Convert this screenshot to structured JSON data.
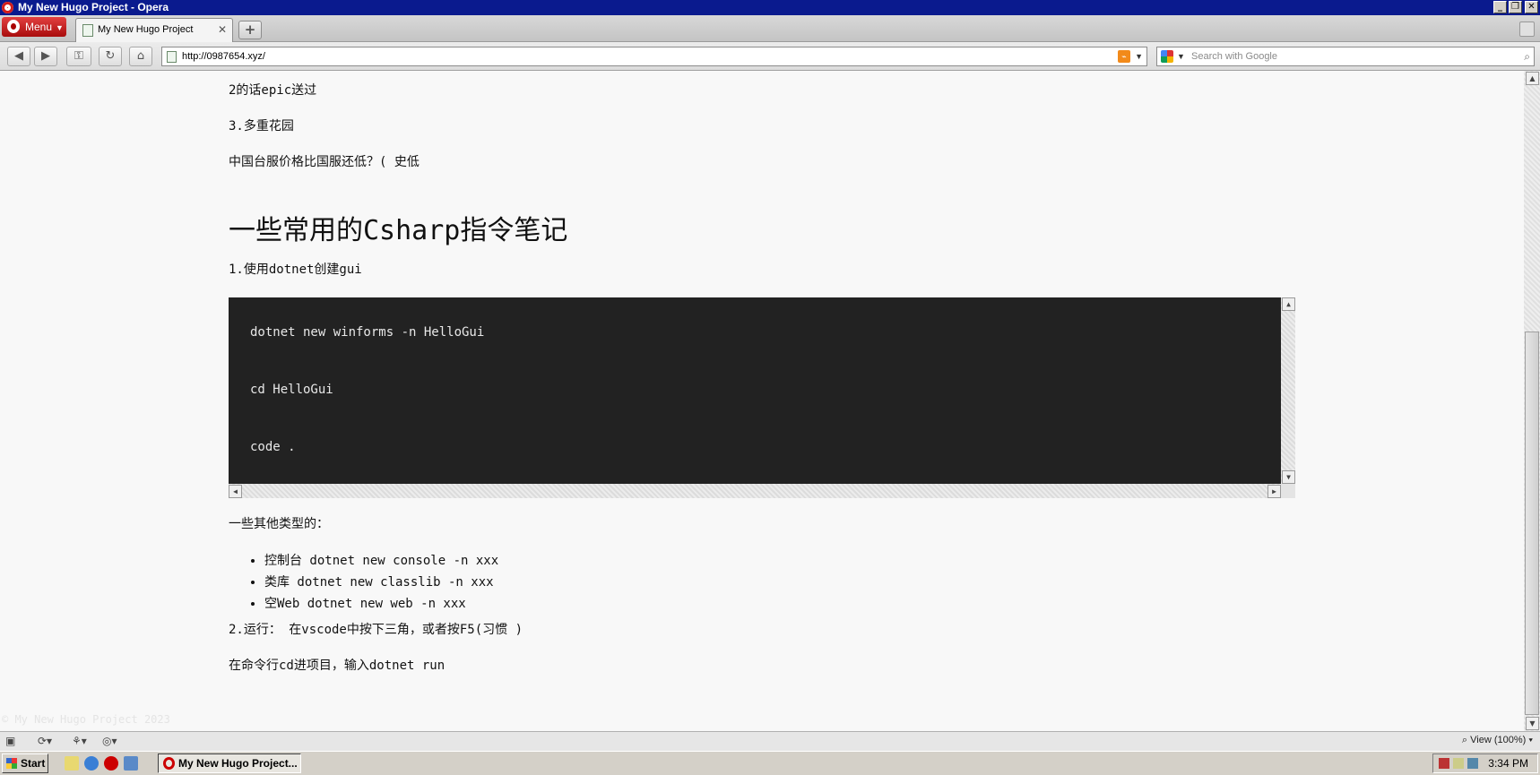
{
  "window": {
    "title": "My New Hugo Project - Opera"
  },
  "browser": {
    "menu_label": "Menu",
    "tab_title": "My New Hugo Project",
    "address_url": "http://0987654.xyz/",
    "search_placeholder": "Search with Google",
    "zoom_label": "View (100%)"
  },
  "page": {
    "lines": [
      "2的话epic送过",
      "3.多重花园",
      "中国台服价格比国服还低？( 史低"
    ],
    "heading": "一些常用的Csharp指令笔记",
    "step1": "1.使用dotnet创建gui",
    "code_lines": [
      "dotnet new winforms -n HelloGui",
      "cd HelloGui",
      "code ."
    ],
    "other_types_label": "一些其他类型的：",
    "bullets": [
      "控制台 dotnet new console -n xxx",
      "类库 dotnet new classlib -n xxx",
      "空Web dotnet new web -n xxx"
    ],
    "step2": "2.运行： 在vscode中按下三角，或者按F5(习惯 )",
    "run_text": "在命令行cd进项目，输入dotnet run",
    "footer": "© My New Hugo Project 2023"
  },
  "taskbar": {
    "start_label": "Start",
    "task_label": "My New Hugo Project...",
    "clock": "3:34 PM"
  },
  "colors": {
    "titlebar": "#0a1a8e",
    "code_bg": "#222222",
    "opera_red": "#c81a1a"
  }
}
